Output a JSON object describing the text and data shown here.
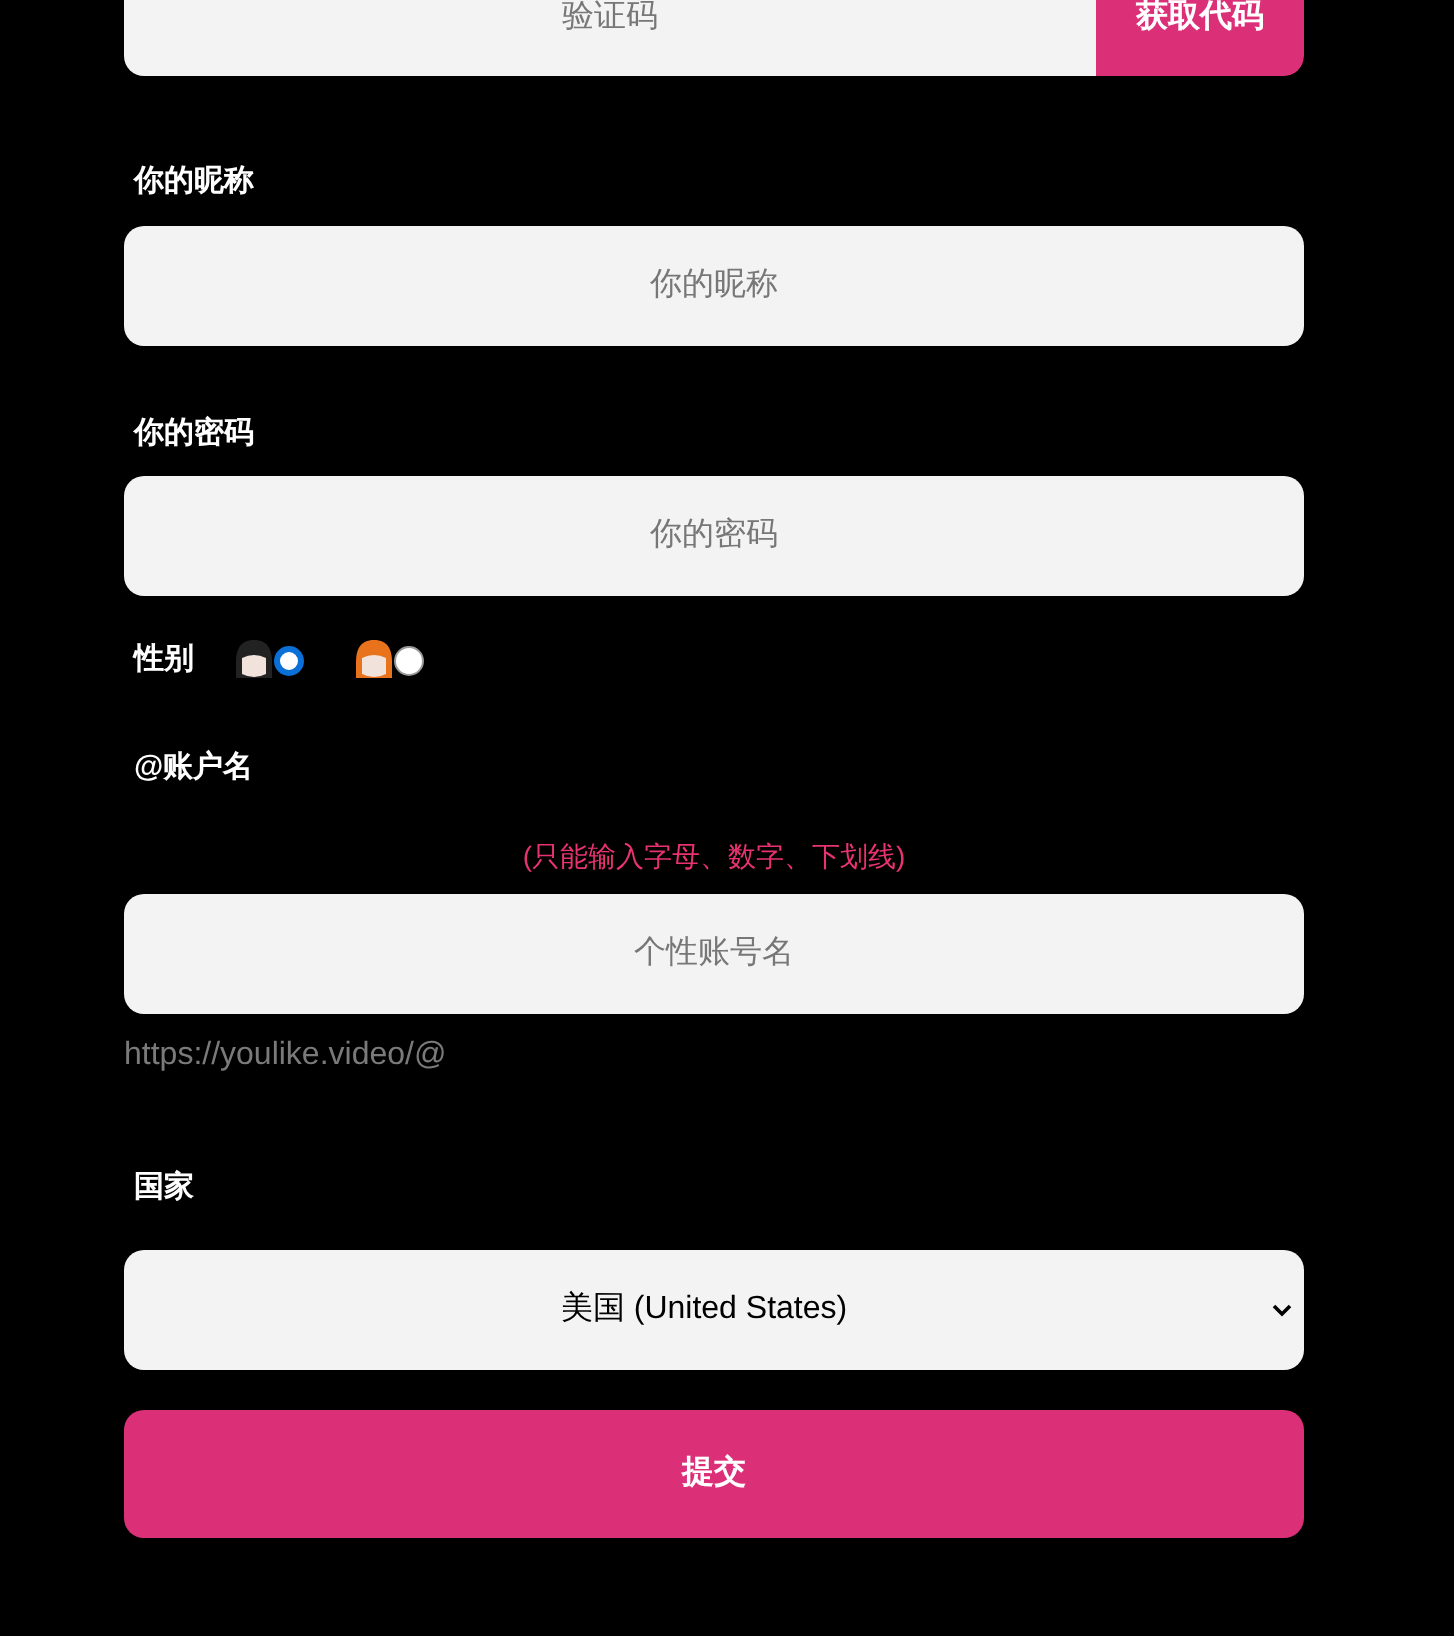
{
  "code_field": {
    "placeholder": "验证码",
    "button": "获取代码"
  },
  "nickname": {
    "label": "你的昵称",
    "placeholder": "你的昵称"
  },
  "password": {
    "label": "你的密码",
    "placeholder": "你的密码"
  },
  "gender": {
    "label": "性别",
    "options": [
      {
        "kind": "dark-hair",
        "selected": true
      },
      {
        "kind": "orange-hair",
        "selected": false
      }
    ]
  },
  "account": {
    "label": "@账户名",
    "hint": "(只能输入字母、数字、下划线)",
    "placeholder": "个性账号名",
    "url_prefix": "https://youlike.video/@"
  },
  "country": {
    "label": "国家",
    "value": "美国 (United States)"
  },
  "submit": "提交"
}
